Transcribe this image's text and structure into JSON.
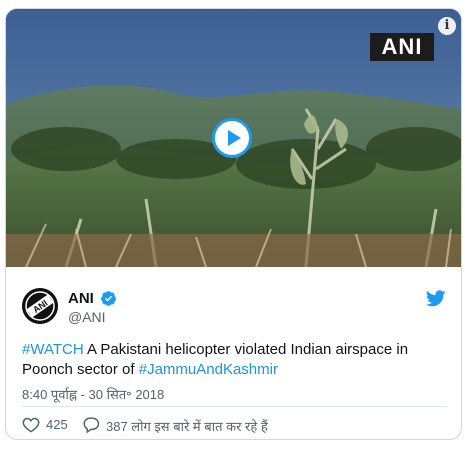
{
  "media": {
    "watermark": "ANI",
    "info_icon": "info-icon",
    "play_icon": "play-icon"
  },
  "author": {
    "name": "ANI",
    "handle": "@ANI",
    "avatar_text": "ANI",
    "verified_icon": "verified-badge-icon"
  },
  "platform_icon": "twitter-bird-icon",
  "tweet": {
    "hashtag_1": "#WATCH",
    "text_middle": " A Pakistani helicopter violated Indian airspace in Poonch sector of ",
    "hashtag_2": "#JammuAndKashmir"
  },
  "timestamp": "8:40 पूर्वाह्न - 30 सित॰ 2018",
  "actions": {
    "likes": "425",
    "replies_text": "387 लोग इस बारे में बात कर रहे हैं"
  },
  "colors": {
    "link": "#1b95e0",
    "accent": "#1d9bf0",
    "text": "#0f1419",
    "muted": "#536471"
  }
}
